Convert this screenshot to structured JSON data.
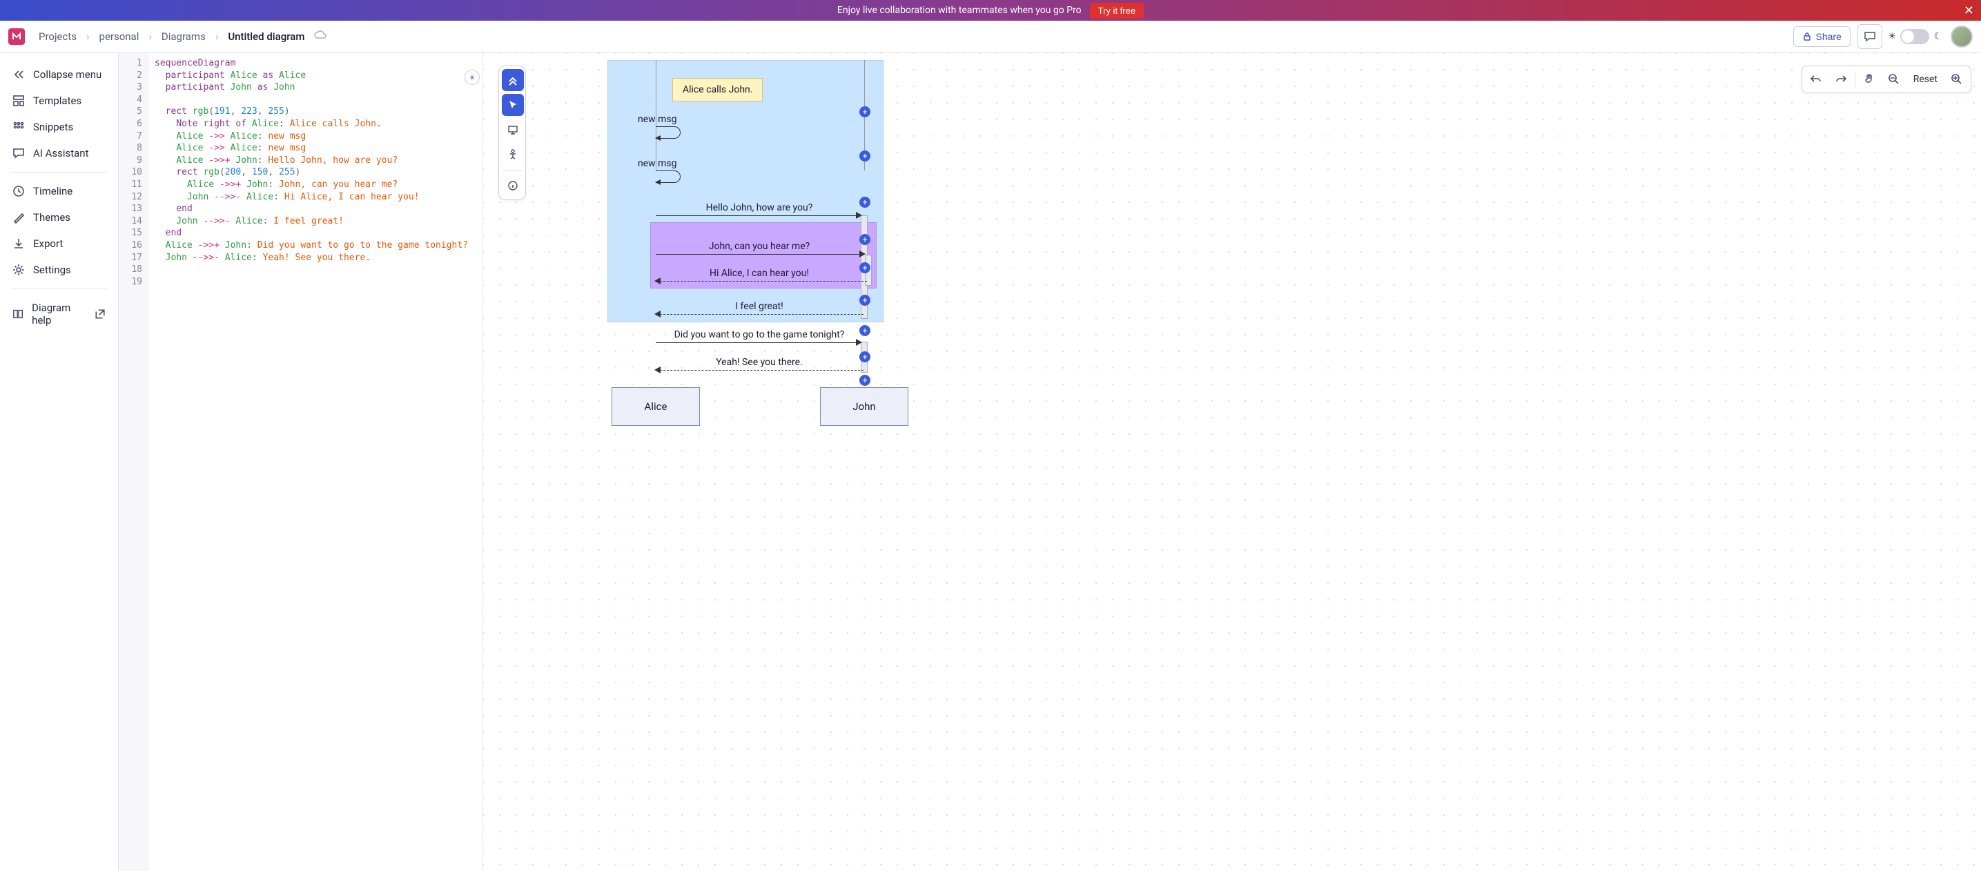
{
  "banner": {
    "text": "Enjoy live collaboration with teammates when you go Pro",
    "cta": "Try it free"
  },
  "breadcrumb": {
    "root": "Projects",
    "folder": "personal",
    "section": "Diagrams",
    "current": "Untitled diagram"
  },
  "topbar": {
    "share": "Share"
  },
  "sidebar": {
    "collapse": "Collapse menu",
    "templates": "Templates",
    "snippets": "Snippets",
    "ai": "AI Assistant",
    "timeline": "Timeline",
    "themes": "Themes",
    "export": "Export",
    "settings": "Settings",
    "help": "Diagram help"
  },
  "editor": {
    "lines": [
      "1",
      "2",
      "3",
      "4",
      "5",
      "6",
      "7",
      "8",
      "9",
      "10",
      "11",
      "12",
      "13",
      "14",
      "15",
      "16",
      "17",
      "18",
      "19"
    ]
  },
  "code": {
    "l1_kw": "sequenceDiagram",
    "l2_kw": "participant",
    "l2_n1": "Alice",
    "l2_as": "as",
    "l2_n2": "Alice",
    "l3_kw": "participant",
    "l3_n1": "John",
    "l3_as": "as",
    "l3_n2": "John",
    "l5_kw": "rect",
    "l5_fn": "rgb",
    "l5_a": "191",
    "l5_b": "223",
    "l5_c": "255",
    "l6_kw": "Note",
    "l6_pos": "right of",
    "l6_who": "Alice",
    "l6_txt": "Alice calls John.",
    "l7_a": "Alice",
    "l7_arr": "->>",
    "l7_b": "Alice",
    "l7_txt": "new msg",
    "l8_a": "Alice",
    "l8_arr": "->>",
    "l8_b": "Alice",
    "l8_txt": "new msg",
    "l9_a": "Alice",
    "l9_arr": "->>+",
    "l9_b": "John",
    "l9_txt": "Hello John, how are you?",
    "l10_kw": "rect",
    "l10_fn": "rgb",
    "l10_a": "200",
    "l10_b": "150",
    "l10_c": "255",
    "l11_a": "Alice",
    "l11_arr": "->>+",
    "l11_b": "John",
    "l11_txt": "John, can you hear me?",
    "l12_a": "John",
    "l12_arr": "-->>-",
    "l12_b": "Alice",
    "l12_txt": "Hi Alice, I can hear you!",
    "l13_kw": "end",
    "l14_a": "John",
    "l14_arr": "-->>-",
    "l14_b": "Alice",
    "l14_txt": "I feel great!",
    "l15_kw": "end",
    "l16_a": "Alice",
    "l16_arr": "->>+",
    "l16_b": "John",
    "l16_txt": "Did you want to go to the game tonight?",
    "l17_a": "John",
    "l17_arr": "-->>-",
    "l17_b": "Alice",
    "l17_txt": "Yeah! See you there."
  },
  "canvas": {
    "reset": "Reset"
  },
  "diagram": {
    "note": "Alice calls John.",
    "m1": "new msg",
    "m2": "new msg",
    "m3": "Hello John, how are you?",
    "m4": "John, can you hear me?",
    "m5": "Hi Alice, I can hear you!",
    "m6": "I feel great!",
    "m7": "Did you want to go to the game tonight?",
    "m8": "Yeah! See you there.",
    "actor_a": "Alice",
    "actor_b": "John"
  },
  "chart_data": {
    "type": "sequence-diagram",
    "participants": [
      "Alice",
      "John"
    ],
    "note": {
      "placement": "right of",
      "actor": "Alice",
      "text": "Alice calls John."
    },
    "blocks": [
      {
        "rect": "rgb(191, 223, 255)",
        "messages": [
          {
            "from": "Alice",
            "to": "Alice",
            "arrow": "->>",
            "text": "new msg"
          },
          {
            "from": "Alice",
            "to": "Alice",
            "arrow": "->>",
            "text": "new msg"
          },
          {
            "from": "Alice",
            "to": "John",
            "arrow": "->>+",
            "text": "Hello John, how are you?"
          },
          {
            "rect": "rgb(200, 150, 255)",
            "messages": [
              {
                "from": "Alice",
                "to": "John",
                "arrow": "->>+",
                "text": "John, can you hear me?"
              },
              {
                "from": "John",
                "to": "Alice",
                "arrow": "-->>-",
                "text": "Hi Alice, I can hear you!"
              }
            ]
          },
          {
            "from": "John",
            "to": "Alice",
            "arrow": "-->>-",
            "text": "I feel great!"
          }
        ]
      }
    ],
    "messages_after": [
      {
        "from": "Alice",
        "to": "John",
        "arrow": "->>+",
        "text": "Did you want to go to the game tonight?"
      },
      {
        "from": "John",
        "to": "Alice",
        "arrow": "-->>-",
        "text": "Yeah! See you there."
      }
    ]
  }
}
